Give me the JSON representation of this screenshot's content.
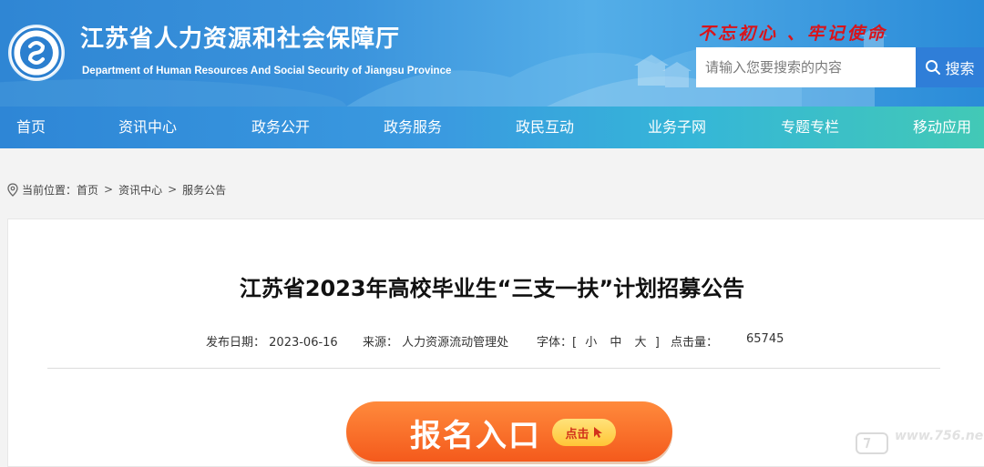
{
  "header": {
    "site_title": "江苏省人力资源和社会保障厅",
    "site_subtitle": "Department of Human Resources And Social Security of Jiangsu Province",
    "slogan": "不忘初心 、牢记使命",
    "logo_icon": "department-seal-logo"
  },
  "search": {
    "placeholder": "请输入您要搜索的内容",
    "button_label": "搜索",
    "icon": "search-icon"
  },
  "nav": {
    "items": [
      {
        "label": "首页"
      },
      {
        "label": "资讯中心"
      },
      {
        "label": "政务公开"
      },
      {
        "label": "政务服务"
      },
      {
        "label": "政民互动"
      },
      {
        "label": "业务子网"
      },
      {
        "label": "专题专栏"
      },
      {
        "label": "移动应用"
      }
    ]
  },
  "breadcrumb": {
    "prefix": "当前位置：",
    "icon": "location-pin-icon",
    "items": [
      "首页",
      "资讯中心",
      "服务公告"
    ],
    "separator": ">"
  },
  "article": {
    "title": "江苏省2023年高校毕业生“三支一扶”计划招募公告",
    "date_label": "发布日期：",
    "date": "2023-06-16",
    "source_label": "来源：",
    "source": "人力资源流动管理处",
    "fontsize_label": "字体：[",
    "fontsize_small": "小",
    "fontsize_medium": "中",
    "fontsize_large": "大",
    "fontsize_close": "]",
    "hits_label": "点击量：",
    "hits": "65745"
  },
  "signup": {
    "label": "报名入口",
    "click_label": "点击",
    "icon": "cursor-pointer-icon"
  },
  "watermark": {
    "text": "www.756.net"
  },
  "colors": {
    "header_blue": "#2f86d4",
    "search_button": "#2f7ed8",
    "slogan_red": "#d9141b",
    "signup_orange": "#f45a1c",
    "click_yellow": "#ffc637"
  }
}
